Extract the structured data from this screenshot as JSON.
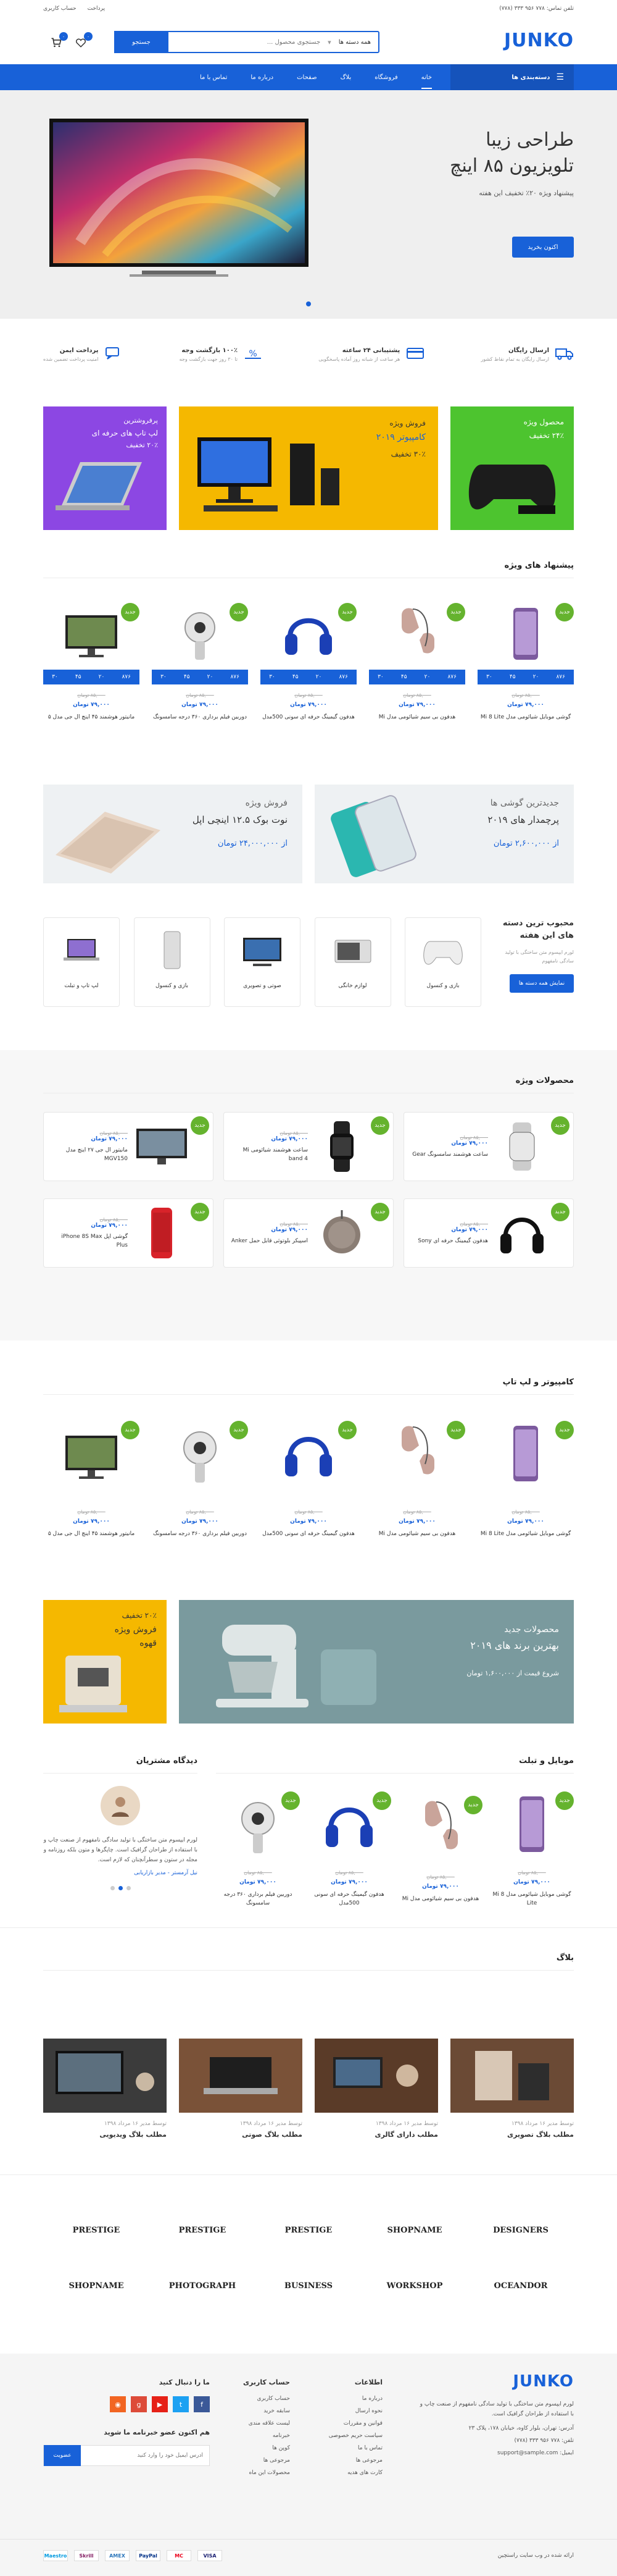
{
  "topbar": {
    "phone": "تلفن تماس: ۷۷۸ ۹۵۶ ۳۳۳ (۷۷۸)",
    "account": "حساب کاربری",
    "checkout": "پرداخت"
  },
  "header": {
    "logo": "JUNKO",
    "search_placeholder": "جستجوی محصول ...",
    "category": "همه دسته ها",
    "search_btn": "جستجو",
    "cart_count": "۰",
    "wish_count": "۰"
  },
  "nav": {
    "categories": "دسته‌بندی ها",
    "items": [
      "خانه",
      "فروشگاه",
      "بلاگ",
      "صفحات",
      "درباره ما",
      "تماس با ما"
    ]
  },
  "hero": {
    "title1": "طراحی زیبا",
    "title2": "تلویزیون ۸۵ اینچ",
    "sub": "پیشنهاد ویژه ۲۰٪ تخفیف این هفته",
    "cta": "اکنون بخرید"
  },
  "features": [
    {
      "t": "ارسال رایگان",
      "d": "ارسال رایگان به تمام نقاط کشور"
    },
    {
      "t": "پشتیبانی ۲۴ ساعته",
      "d": "هر ساعت از شبانه روز آماده پاسخگویی"
    },
    {
      "t": "۱۰۰٪ بازگشت وجه",
      "d": "تا ۳۰ روز جهت بازگشت وجه"
    },
    {
      "t": "پرداخت ایمن",
      "d": "امنیت پرداخت تضمین شده"
    }
  ],
  "promos": [
    {
      "t": "محصول ویژه",
      "s": "۲۴٪ تخفیف"
    },
    {
      "t": "فروش ویژه",
      "s": "کامپیوتر ۲۰۱۹",
      "x": "۳۰٪ تخفیف"
    },
    {
      "t": "پرفروشترین",
      "s": "لپ تاپ های حرفه ای",
      "x": "۲۰٪ تخفیف"
    }
  ],
  "special": {
    "title": "پیشنهاد های ویژه",
    "badge": "جدید",
    "timer": [
      "۸۷۶",
      "۲۰",
      "۴۵",
      "۳۰"
    ],
    "products": [
      {
        "name": "گوشی موبایل شیائومی مدل Mi 8 Lite",
        "old": "۸۵,۰۰۰ تومان",
        "new": "۷۹,۰۰۰ تومان"
      },
      {
        "name": "هدفون بی سیم شیائومی مدل Mi",
        "old": "۸۵,۰۰۰ تومان",
        "new": "۷۹,۰۰۰ تومان"
      },
      {
        "name": "هدفون گیمینگ حرفه ای سونی 500مدل",
        "old": "۸۵,۰۰۰ تومان",
        "new": "۷۹,۰۰۰ تومان"
      },
      {
        "name": "دوربین فیلم برداری ۳۶۰ درجه سامسونگ",
        "old": "۸۵,۰۰۰ تومان",
        "new": "۷۹,۰۰۰ تومان"
      },
      {
        "name": "مانیتور هوشمند ۴۵ اینچ ال جی مدل ۵",
        "old": "۸۵,۰۰۰ تومان",
        "new": "۷۹,۰۰۰ تومان"
      }
    ]
  },
  "banners": [
    {
      "t": "جدیدترین گوشی ها",
      "s": "پرچمدار های ۲۰۱۹",
      "p": "از ۲,۶۰۰,۰۰۰ تومان"
    },
    {
      "t": "فروش ویژه",
      "s": "نوت بوک ۱۲.۵ اینچی اپل",
      "p": "از ۲۴,۰۰۰,۰۰۰ تومان"
    }
  ],
  "popular": {
    "title": "محبوب ترین دسته های این هفته",
    "desc": "لورم ایپسوم متن ساختگی با تولید سادگی نامفهوم",
    "btn": "نمایش همه دسته ها",
    "cats": [
      "بازی و کنسول",
      "لوازم خانگی",
      "صوتی و تصویری",
      "بازی و کنسول",
      "لپ تاپ و تبلت"
    ]
  },
  "featured": {
    "title": "محصولات ویژه",
    "badge": "جدید",
    "items": [
      {
        "name": "ساعت هوشمند سامسونگ Gear",
        "old": "۸۵,۰۰۰ تومان",
        "new": "۷۹,۰۰۰ تومان"
      },
      {
        "name": "ساعت هوشمند شیائومی Mi band 4",
        "old": "۸۵,۰۰۰ تومان",
        "new": "۷۹,۰۰۰ تومان"
      },
      {
        "name": "مانیتور ال جی ۲۷ اینچ مدل MGV150",
        "old": "۸۵,۰۰۰ تومان",
        "new": "۷۹,۰۰۰ تومان"
      },
      {
        "name": "هدفون گیمینگ حرفه ای Sony",
        "old": "۸۵,۰۰۰ تومان",
        "new": "۷۹,۰۰۰ تومان"
      },
      {
        "name": "اسپیکر بلوتوثی قابل حمل Anker",
        "old": "۸۵,۰۰۰ تومان",
        "new": "۷۹,۰۰۰ تومان"
      },
      {
        "name": "گوشی اپل iPhone 8S Max Plus",
        "old": "۸۵,۰۰۰ تومان",
        "new": "۷۹,۰۰۰ تومان"
      }
    ]
  },
  "laptops": {
    "title": "کامپیوتر و لپ تاپ",
    "badge": "جدید",
    "products": [
      {
        "name": "گوشی موبایل شیائومی مدل Mi 8 Lite",
        "old": "۸۵,۰۰۰ تومان",
        "new": "۷۹,۰۰۰ تومان"
      },
      {
        "name": "هدفون بی سیم شیائومی مدل Mi",
        "old": "۸۵,۰۰۰ تومان",
        "new": "۷۹,۰۰۰ تومان"
      },
      {
        "name": "هدفون گیمینگ حرفه ای سونی 500مدل",
        "old": "۸۵,۰۰۰ تومان",
        "new": "۷۹,۰۰۰ تومان"
      },
      {
        "name": "دوربین فیلم برداری ۳۶۰ درجه سامسونگ",
        "old": "۸۵,۰۰۰ تومان",
        "new": "۷۹,۰۰۰ تومان"
      },
      {
        "name": "مانیتور هوشمند ۴۵ اینچ ال جی مدل ۵",
        "old": "۸۵,۰۰۰ تومان",
        "new": "۷۹,۰۰۰ تومان"
      }
    ]
  },
  "bigbanners": [
    {
      "t": "محصولات جدید",
      "s": "بهترین برند های ۲۰۱۹",
      "p": "شروع قیمت از ۱,۶۰۰,۰۰۰ تومان"
    },
    {
      "t": "۲۰٪ تخفیف",
      "s": "فروش ویژه",
      "x": "قهوه"
    }
  ],
  "mobile": {
    "title": "موبایل و تبلت",
    "badge": "جدید",
    "products": [
      {
        "name": "گوشی موبایل شیائومی مدل Mi 8 Lite",
        "old": "۸۵,۰۰۰ تومان",
        "new": "۷۹,۰۰۰ تومان"
      },
      {
        "name": "هدفون بی سیم شیائومی مدل Mi",
        "old": "۸۵,۰۰۰ تومان",
        "new": "۷۹,۰۰۰ تومان"
      },
      {
        "name": "هدفون گیمینگ حرفه ای سونی 500مدل",
        "old": "۸۵,۰۰۰ تومان",
        "new": "۷۹,۰۰۰ تومان"
      },
      {
        "name": "دوربین فیلم برداری ۳۶۰ درجه سامسونگ",
        "old": "۸۵,۰۰۰ تومان",
        "new": "۷۹,۰۰۰ تومان"
      }
    ]
  },
  "testimonial": {
    "title": "دیدگاه مشتریان",
    "text": "لورم ایپسوم متن ساختگی با تولید سادگی نامفهوم از صنعت چاپ و با استفاده از طراحان گرافیک است. چاپگرها و متون بلکه روزنامه و مجله در ستون و سطرآنچنان که لازم است.",
    "author": "نیل آرمستر - مدیر بازاریابی"
  },
  "blog": {
    "title": "بلاگ",
    "posts": [
      {
        "title": "مطلب بلاگ تصویری",
        "meta": "توسط مدیر ۱۶ مرداد ۱۳۹۸"
      },
      {
        "title": "مطلب دارای گالری",
        "meta": "توسط مدیر ۱۶ مرداد ۱۳۹۸"
      },
      {
        "title": "مطلب بلاگ صوتی",
        "meta": "توسط مدیر ۱۶ مرداد ۱۳۹۸"
      },
      {
        "title": "مطلب بلاگ ویدیویی",
        "meta": "توسط مدیر ۱۶ مرداد ۱۳۹۸"
      }
    ]
  },
  "brands": [
    "DESIGNERS",
    "SHOPNAME",
    "PRESTIGE",
    "PRESTIGE",
    "PRESTIGE",
    "OCEANDOR",
    "WORKSHOP",
    "BUSINESS",
    "PHOTOGRAPH",
    "SHOPNAME"
  ],
  "footer": {
    "logo": "JUNKO",
    "about": "لورم ایپسوم متن ساختگی با تولید سادگی نامفهوم از صنعت چاپ و با استفاده از طراحان گرافیک است.",
    "address": "آدرس: تهران، بلوار کاوه، خیابان ۱۷۸، پلاک ۲۳",
    "phone": "تلفن: ۷۷۸ ۹۵۶ ۳۳۳ (۷۷۸)",
    "email": "ایمیل: support@sample.com",
    "col1": {
      "title": "اطلاعات",
      "items": [
        "درباره ما",
        "نحوه ارسال",
        "قوانین و مقررات",
        "سیاست حریم خصوصی",
        "تماس با ما",
        "مرجوعی ها",
        "کارت های هدیه"
      ]
    },
    "col2": {
      "title": "حساب کاربری",
      "items": [
        "حساب کاربری",
        "سابقه خرید",
        "لیست علاقه مندی",
        "خبرنامه",
        "کوپن ها",
        "مرجوعی ها",
        "محصولات این ماه"
      ]
    },
    "follow": "ما را دنبال کنید",
    "newsletter": "هم اکنون عضو خبرنامه ما شوید",
    "news_placeholder": "آدرس ایمیل خود را وارد کنید",
    "news_btn": "عضویت",
    "copyright": "ارائه شده در وب سایت راستچین",
    "payments": [
      "VISA",
      "MC",
      "PayPal",
      "AMEX",
      "Skrill",
      "Maestro"
    ]
  }
}
